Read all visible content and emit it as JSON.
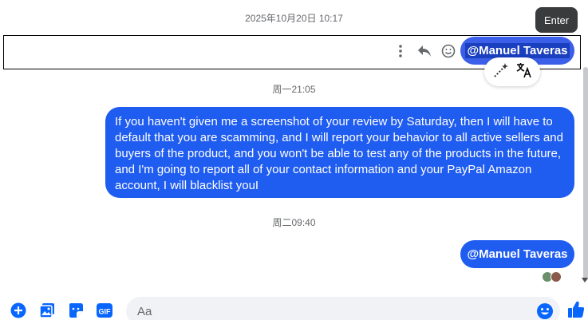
{
  "timestamps": [
    "2025年10月20日 10:17",
    "周一21:05",
    "周二09:40"
  ],
  "tooltip": "Enter",
  "messages": {
    "mention_top": "@Manuel Taveras",
    "long_text": "If you haven't given me a screenshot of your review by Saturday, then I will have to default that you are scamming, and I will report your behavior to all active sellers and buyers of the product, and you won't be able to test any of the products in the future, and I'm going to report all of your contact information and your PayPal Amazon account, I will blacklist youI",
    "mention_bottom": "@Manuel Taveras"
  },
  "composer": {
    "placeholder": "Aa"
  },
  "colors": {
    "bubble": "#1f5cf0",
    "accent": "#0866ff"
  },
  "icons": [
    "more-icon",
    "reply-icon",
    "emoji-reaction-icon",
    "magic-wand-icon",
    "translate-icon",
    "plus-circle-icon",
    "gallery-icon",
    "sticker-icon",
    "gif-icon",
    "emoji-icon",
    "thumbs-up-icon"
  ]
}
